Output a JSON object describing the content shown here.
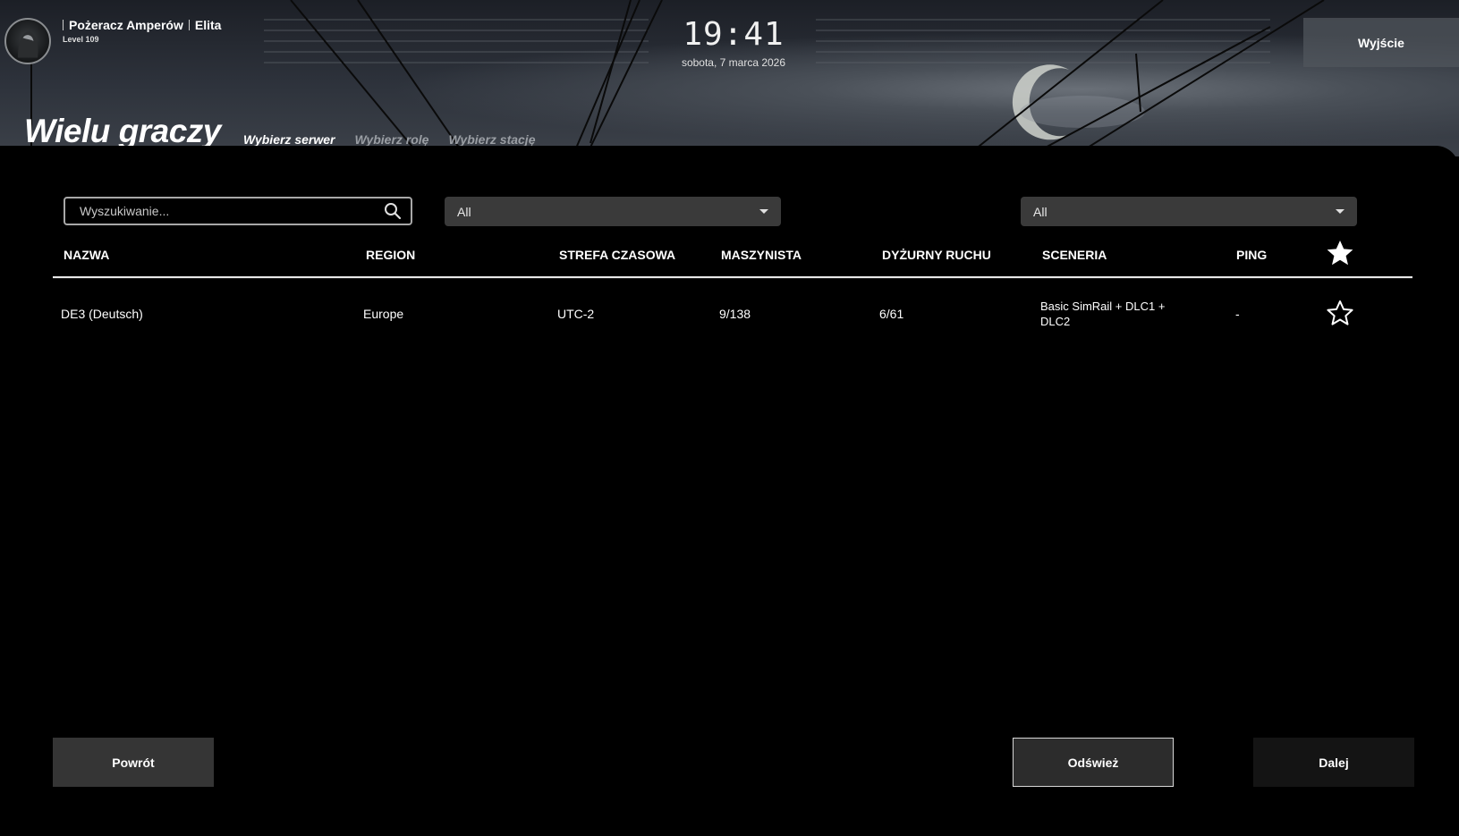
{
  "player": {
    "name": "Pożeracz Amperów",
    "rank": "Elita",
    "level": "Level 109"
  },
  "clock": {
    "time": "19:41",
    "date": "sobota, 7 marca 2026"
  },
  "header": {
    "exit_label": "Wyjście",
    "title": "Wielu graczy"
  },
  "steps": [
    {
      "label": "Wybierz serwer",
      "active": true
    },
    {
      "label": "Wybierz rolę",
      "active": false
    },
    {
      "label": "Wybierz stację",
      "active": false
    }
  ],
  "filters": {
    "search_placeholder": "Wyszukiwanie...",
    "region_value": "All",
    "scenery_value": "All"
  },
  "table": {
    "columns": [
      "NAZWA",
      "REGION",
      "STREFA CZASOWA",
      "MASZYNISTA",
      "DYŻURNY RUCHU",
      "SCENERIA",
      "PING"
    ],
    "rows": [
      {
        "name": "DE3 (Deutsch)",
        "region": "Europe",
        "timezone": "UTC-2",
        "drivers": "9/138",
        "dispatchers": "6/61",
        "scenery": "Basic SimRail + DLC1 + DLC2",
        "ping": "-",
        "favorite": false
      }
    ]
  },
  "footer": {
    "back_label": "Powrót",
    "refresh_label": "Odśwież",
    "next_label": "Dalej"
  },
  "colors": {
    "background": "#000000",
    "button_dark": "#353535",
    "select_bg": "#3a3a3a"
  },
  "icons": {
    "search": "search-icon",
    "favorite_header": "star-filled-icon",
    "favorite_row": "star-outline-icon"
  }
}
